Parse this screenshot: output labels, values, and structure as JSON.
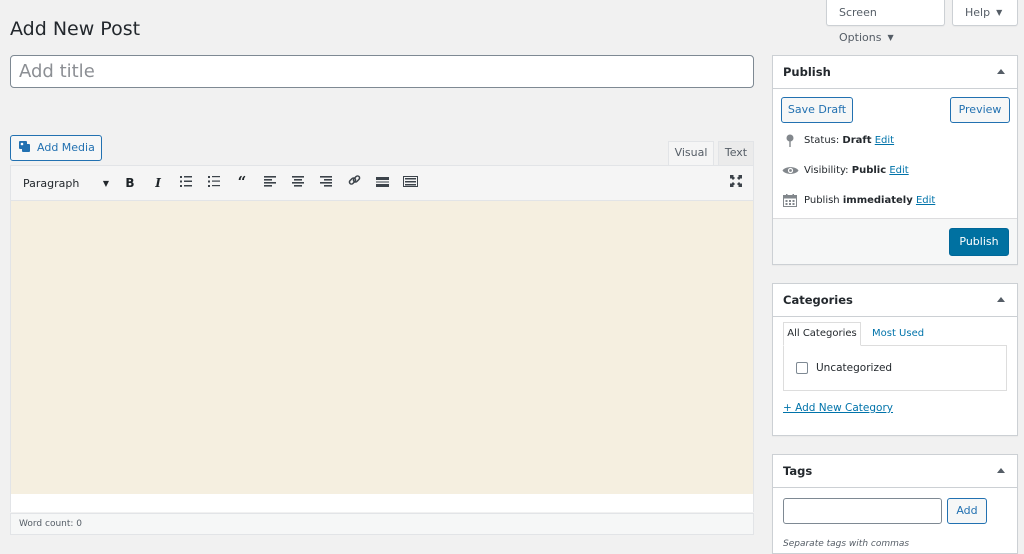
{
  "top": {
    "screen_options": "Screen Options",
    "help": "Help",
    "arrow": "▼"
  },
  "page_title": "Add New Post",
  "title_placeholder": "Add title",
  "add_media": "Add Media",
  "editor": {
    "tabs": [
      "Visual",
      "Text"
    ],
    "format_select": "Paragraph",
    "toolbar_icons": [
      "bold-icon",
      "italic-icon",
      "bullet-list-icon",
      "numbered-list-icon",
      "blockquote-icon",
      "align-left-icon",
      "align-center-icon",
      "align-right-icon",
      "link-icon",
      "read-more-icon",
      "toolbar-toggle-icon"
    ],
    "word_count": "Word count: 0"
  },
  "publish": {
    "heading": "Publish",
    "save_draft": "Save Draft",
    "preview": "Preview",
    "status_label": "Status:",
    "status_value": "Draft",
    "visibility_label": "Visibility:",
    "visibility_value": "Public",
    "publish_label": "Publish",
    "publish_value": "immediately",
    "edit": "Edit",
    "publish_button": "Publish"
  },
  "categories": {
    "heading": "Categories",
    "tabs": [
      "All Categories",
      "Most Used"
    ],
    "items": [
      "Uncategorized"
    ],
    "add_new": "+ Add New Category"
  },
  "tags": {
    "heading": "Tags",
    "add": "Add",
    "hint": "Separate tags with commas"
  },
  "colors": {
    "accent": "#0071a1",
    "editor_bg": "#f5efe0"
  }
}
